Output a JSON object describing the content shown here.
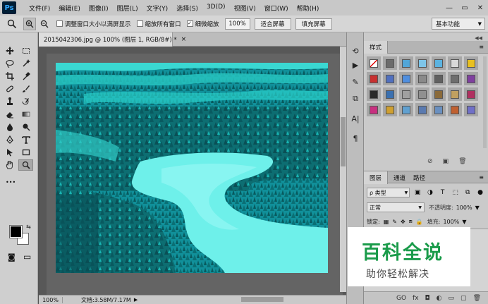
{
  "app": {
    "logo": "Ps"
  },
  "menu": [
    "文件(F)",
    "编辑(E)",
    "图像(I)",
    "图层(L)",
    "文字(Y)",
    "选择(S)",
    "3D(D)",
    "视图(V)",
    "窗口(W)",
    "帮助(H)"
  ],
  "window_controls": {
    "minimize": "—",
    "restore": "▭",
    "close": "✕"
  },
  "options": {
    "resize_windows": "调整窗口大小以满屏显示",
    "zoom_all": "缩放所有窗口",
    "scrubby_zoom": "细微缩放",
    "zoom_value": "100%",
    "fit_screen": "适合屏幕",
    "fill_screen": "填充屏幕",
    "workspace": "基本功能",
    "checks": {
      "resize_windows": false,
      "zoom_all": false,
      "scrubby_zoom": true
    }
  },
  "document": {
    "tab_title": "2015042306.jpg @ 100% (图层 1, RGB/8#) *",
    "close": "×",
    "zoom": "100%",
    "doc_size": "文档:3.58M/7.17M",
    "image_tint": "#1ec9c6"
  },
  "tools": [
    "move-tool",
    "marquee-tool",
    "lasso-tool",
    "magic-wand-tool",
    "crop-tool",
    "eyedropper-tool",
    "healing-brush-tool",
    "brush-tool",
    "clone-stamp-tool",
    "history-brush-tool",
    "eraser-tool",
    "gradient-tool",
    "blur-tool",
    "dodge-tool",
    "pen-tool",
    "type-tool",
    "path-selection-tool",
    "rectangle-tool",
    "hand-tool",
    "zoom-tool"
  ],
  "tool_glyphs": {
    "more": "•••",
    "swap": "⇆",
    "quick_mask": "◙",
    "screen_mode": "▭"
  },
  "colors": {
    "foreground": "#000000",
    "background": "#ffffff"
  },
  "dock": {
    "history": "⟲",
    "play": "▶",
    "brush": "✎",
    "clone": "⧉",
    "type": "A|",
    "paragraph": "¶"
  },
  "styles_panel": {
    "tab": "样式",
    "menu": "≡",
    "swatches": [
      "#ffffff",
      "#6b6b6b",
      "#52a6d8",
      "#7ec5e8",
      "#5bb3e0",
      "#d8d8d8",
      "#e8c020",
      "#c83030",
      "#5070c0",
      "#4f8fe0",
      "#8a8a8a",
      "#606060",
      "#6e6e6e",
      "#8040a0",
      "#2a2a2a",
      "#3a70b0",
      "#a0a0a0",
      "#909090",
      "#8a6a3a",
      "#c0a060",
      "#b03060",
      "#c83080",
      "#d0a030",
      "#60a0d0",
      "#5a7ab0",
      "#6a90c0",
      "#c06030",
      "#7070c8"
    ],
    "footer": [
      "⊘",
      "▣",
      "🗑"
    ]
  },
  "layers_panel": {
    "tabs": [
      "图层",
      "通道",
      "路径"
    ],
    "filter_label": "ρ 类型",
    "blend_mode": "正常",
    "opacity_label": "不透明度:",
    "opacity_value": "100%",
    "lock_label": "锁定:",
    "fill_label": "填充:",
    "fill_value": "100%",
    "footer": [
      "GO",
      "fx",
      "◘",
      "◐",
      "▭",
      "▢",
      "🗑"
    ]
  },
  "watermark": {
    "title": "百科全说",
    "subtitle": "助你轻松解决"
  }
}
